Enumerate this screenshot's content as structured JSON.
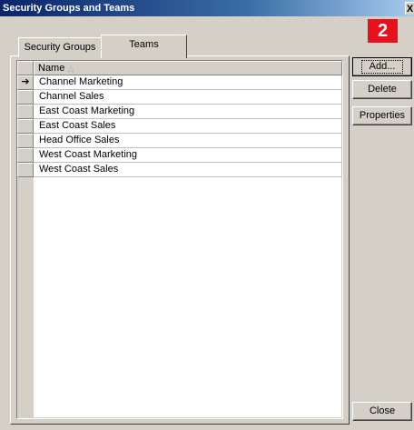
{
  "window": {
    "title": "Security Groups and Teams",
    "close_glyph": "X"
  },
  "badge": "2",
  "tabs": [
    {
      "label": "Security Groups",
      "active": false
    },
    {
      "label": "Teams",
      "active": true
    }
  ],
  "grid": {
    "column_header": "Name",
    "sort_indicator": "△",
    "current_row_marker": "➔",
    "rows": [
      "Channel Marketing",
      "Channel Sales",
      "East Coast Marketing",
      "East Coast Sales",
      "Head Office Sales",
      "West Coast Marketing",
      "West Coast Sales"
    ]
  },
  "buttons": {
    "add": "Add...",
    "delete": "Delete",
    "properties": "Properties",
    "close": "Close"
  },
  "colors": {
    "badge": "#e8101c",
    "title_start": "#0a246a",
    "face": "#d4d0c8"
  }
}
